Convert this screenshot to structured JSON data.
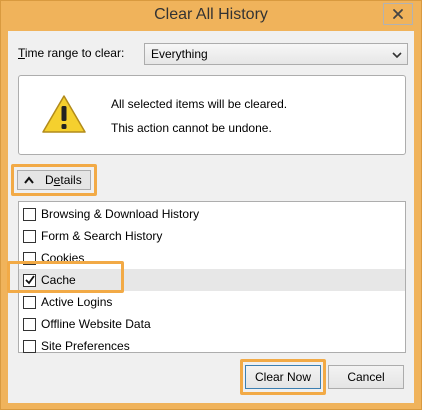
{
  "window": {
    "title": "Clear All History"
  },
  "time_range": {
    "label_prefix": "T",
    "label_rest": "ime range to clear:",
    "value": "Everything"
  },
  "warning": {
    "line1": "All selected items will be cleared.",
    "line2": "This action cannot be undone."
  },
  "details": {
    "label_prefix": "D",
    "label_underlined": "e",
    "label_rest": "tails"
  },
  "items": [
    {
      "label": "Browsing & Download History",
      "checked": false
    },
    {
      "label": "Form & Search History",
      "checked": false
    },
    {
      "label": "Cookies",
      "checked": false
    },
    {
      "label": "Cache",
      "checked": true
    },
    {
      "label": "Active Logins",
      "checked": false
    },
    {
      "label": "Offline Website Data",
      "checked": false
    },
    {
      "label": "Site Preferences",
      "checked": false
    }
  ],
  "buttons": {
    "clear_now": "Clear Now",
    "cancel": "Cancel"
  },
  "colors": {
    "highlight": "#f2aa46",
    "title_bar": "#f0b35b",
    "warning_yellow": "#f5d02e"
  },
  "icons": {
    "close": "close-icon",
    "warning": "warning-icon",
    "dropdown": "chevron-down-icon",
    "details": "chevron-up-icon",
    "check": "checkmark-icon"
  }
}
